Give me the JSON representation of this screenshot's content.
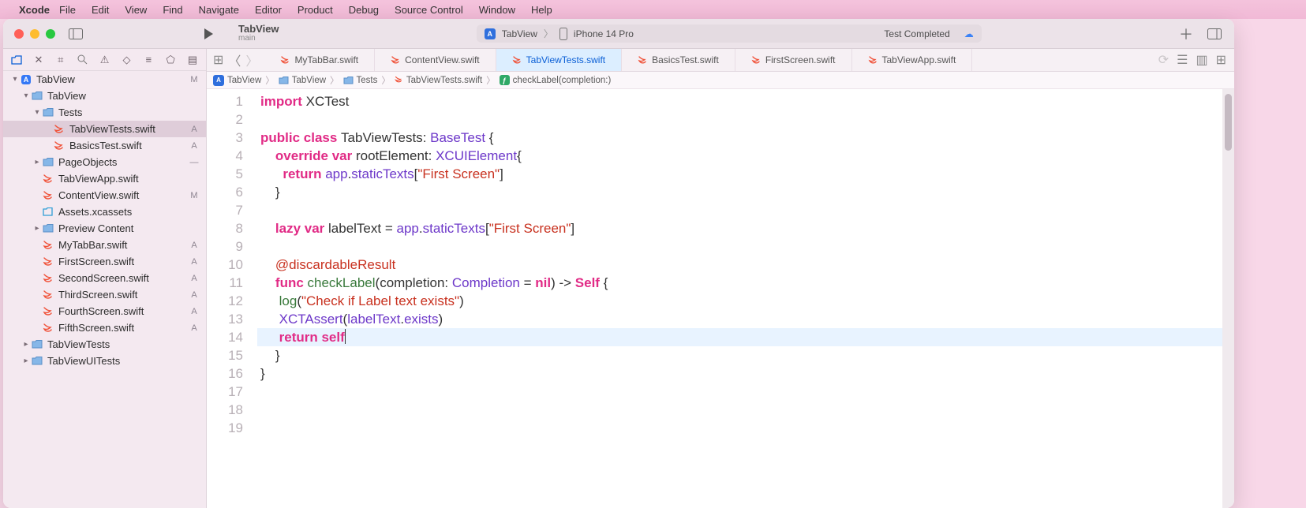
{
  "menubar": {
    "app": "Xcode",
    "items": [
      "File",
      "Edit",
      "View",
      "Find",
      "Navigate",
      "Editor",
      "Product",
      "Debug",
      "Source Control",
      "Window",
      "Help"
    ]
  },
  "toolbar": {
    "project": "TabView",
    "branch": "main",
    "scheme": "TabView",
    "device": "iPhone 14 Pro",
    "status": "Test Completed"
  },
  "navigator": {
    "rows": [
      {
        "indent": 0,
        "arrow": "down",
        "icon": "app",
        "label": "TabView",
        "status": "M"
      },
      {
        "indent": 1,
        "arrow": "down",
        "icon": "folder",
        "label": "TabView",
        "status": ""
      },
      {
        "indent": 2,
        "arrow": "down",
        "icon": "folder",
        "label": "Tests",
        "status": ""
      },
      {
        "indent": 3,
        "arrow": "",
        "icon": "swift",
        "label": "TabViewTests.swift",
        "status": "A",
        "selected": true
      },
      {
        "indent": 3,
        "arrow": "",
        "icon": "swift",
        "label": "BasicsTest.swift",
        "status": "A"
      },
      {
        "indent": 2,
        "arrow": "right",
        "icon": "folder",
        "label": "PageObjects",
        "status": "—"
      },
      {
        "indent": 2,
        "arrow": "",
        "icon": "swift",
        "label": "TabViewApp.swift",
        "status": ""
      },
      {
        "indent": 2,
        "arrow": "",
        "icon": "swift",
        "label": "ContentView.swift",
        "status": "M"
      },
      {
        "indent": 2,
        "arrow": "",
        "icon": "assets",
        "label": "Assets.xcassets",
        "status": ""
      },
      {
        "indent": 2,
        "arrow": "right",
        "icon": "folder",
        "label": "Preview Content",
        "status": ""
      },
      {
        "indent": 2,
        "arrow": "",
        "icon": "swift",
        "label": "MyTabBar.swift",
        "status": "A"
      },
      {
        "indent": 2,
        "arrow": "",
        "icon": "swift",
        "label": "FirstScreen.swift",
        "status": "A"
      },
      {
        "indent": 2,
        "arrow": "",
        "icon": "swift",
        "label": "SecondScreen.swift",
        "status": "A"
      },
      {
        "indent": 2,
        "arrow": "",
        "icon": "swift",
        "label": "ThirdScreen.swift",
        "status": "A"
      },
      {
        "indent": 2,
        "arrow": "",
        "icon": "swift",
        "label": "FourthScreen.swift",
        "status": "A"
      },
      {
        "indent": 2,
        "arrow": "",
        "icon": "swift",
        "label": "FifthScreen.swift",
        "status": "A"
      },
      {
        "indent": 1,
        "arrow": "right",
        "icon": "folder",
        "label": "TabViewTests",
        "status": ""
      },
      {
        "indent": 1,
        "arrow": "right",
        "icon": "folder",
        "label": "TabViewUITests",
        "status": ""
      }
    ]
  },
  "tabs": [
    {
      "label": "MyTabBar.swift"
    },
    {
      "label": "ContentView.swift"
    },
    {
      "label": "TabViewTests.swift",
      "active": true
    },
    {
      "label": "BasicsTest.swift"
    },
    {
      "label": "FirstScreen.swift"
    },
    {
      "label": "TabViewApp.swift"
    }
  ],
  "jumpbar": {
    "items": [
      {
        "icon": "app",
        "label": "TabView"
      },
      {
        "icon": "folder",
        "label": "TabView"
      },
      {
        "icon": "folder",
        "label": "Tests"
      },
      {
        "icon": "swift",
        "label": "TabViewTests.swift"
      },
      {
        "icon": "fn",
        "label": "checkLabel(completion:)"
      }
    ]
  },
  "code": {
    "lines": [
      [
        {
          "t": "import ",
          "c": "kw"
        },
        {
          "t": "XCTest",
          "c": "plain"
        }
      ],
      [],
      [
        {
          "t": "public class ",
          "c": "kw"
        },
        {
          "t": "TabViewTests",
          "c": "plain"
        },
        {
          "t": ": ",
          "c": "plain"
        },
        {
          "t": "BaseTest",
          "c": "type"
        },
        {
          "t": " {",
          "c": "plain"
        }
      ],
      [
        {
          "t": "    ",
          "c": "plain"
        },
        {
          "t": "override var ",
          "c": "kw"
        },
        {
          "t": "rootElement: ",
          "c": "plain"
        },
        {
          "t": "XCUIElement",
          "c": "type"
        },
        {
          "t": "{",
          "c": "plain"
        }
      ],
      [
        {
          "t": "      ",
          "c": "plain"
        },
        {
          "t": "return ",
          "c": "kw"
        },
        {
          "t": "app",
          "c": "type"
        },
        {
          "t": ".",
          "c": "plain"
        },
        {
          "t": "staticTexts",
          "c": "type"
        },
        {
          "t": "[",
          "c": "plain"
        },
        {
          "t": "\"First Screen\"",
          "c": "str"
        },
        {
          "t": "]",
          "c": "plain"
        }
      ],
      [
        {
          "t": "    }",
          "c": "plain"
        }
      ],
      [],
      [
        {
          "t": "    ",
          "c": "plain"
        },
        {
          "t": "lazy var ",
          "c": "kw"
        },
        {
          "t": "labelText = ",
          "c": "plain"
        },
        {
          "t": "app",
          "c": "type"
        },
        {
          "t": ".",
          "c": "plain"
        },
        {
          "t": "staticTexts",
          "c": "type"
        },
        {
          "t": "[",
          "c": "plain"
        },
        {
          "t": "\"First Screen\"",
          "c": "str"
        },
        {
          "t": "]",
          "c": "plain"
        }
      ],
      [],
      [
        {
          "t": "    ",
          "c": "plain"
        },
        {
          "t": "@discardableResult",
          "c": "attr"
        }
      ],
      [
        {
          "t": "    ",
          "c": "plain"
        },
        {
          "t": "func ",
          "c": "kw"
        },
        {
          "t": "checkLabel",
          "c": "prop"
        },
        {
          "t": "(completion: ",
          "c": "plain"
        },
        {
          "t": "Completion",
          "c": "type"
        },
        {
          "t": " = ",
          "c": "plain"
        },
        {
          "t": "nil",
          "c": "kw"
        },
        {
          "t": ") -> ",
          "c": "plain"
        },
        {
          "t": "Self",
          "c": "kw"
        },
        {
          "t": " {",
          "c": "plain"
        }
      ],
      [
        {
          "t": "     ",
          "c": "plain"
        },
        {
          "t": "log",
          "c": "prop"
        },
        {
          "t": "(",
          "c": "plain"
        },
        {
          "t": "\"Check if Label text exists\"",
          "c": "str"
        },
        {
          "t": ")",
          "c": "plain"
        }
      ],
      [
        {
          "t": "     ",
          "c": "plain"
        },
        {
          "t": "XCTAssert",
          "c": "type"
        },
        {
          "t": "(",
          "c": "plain"
        },
        {
          "t": "labelText",
          "c": "type"
        },
        {
          "t": ".",
          "c": "plain"
        },
        {
          "t": "exists",
          "c": "type"
        },
        {
          "t": ")",
          "c": "plain"
        }
      ],
      [
        {
          "t": "     ",
          "c": "plain"
        },
        {
          "t": "return ",
          "c": "kw"
        },
        {
          "t": "self",
          "c": "kw"
        }
      ],
      [
        {
          "t": "    }",
          "c": "plain"
        }
      ],
      [
        {
          "t": "}",
          "c": "plain"
        }
      ],
      [],
      [],
      []
    ],
    "highlight_line": 14,
    "cursor_line": 14
  }
}
